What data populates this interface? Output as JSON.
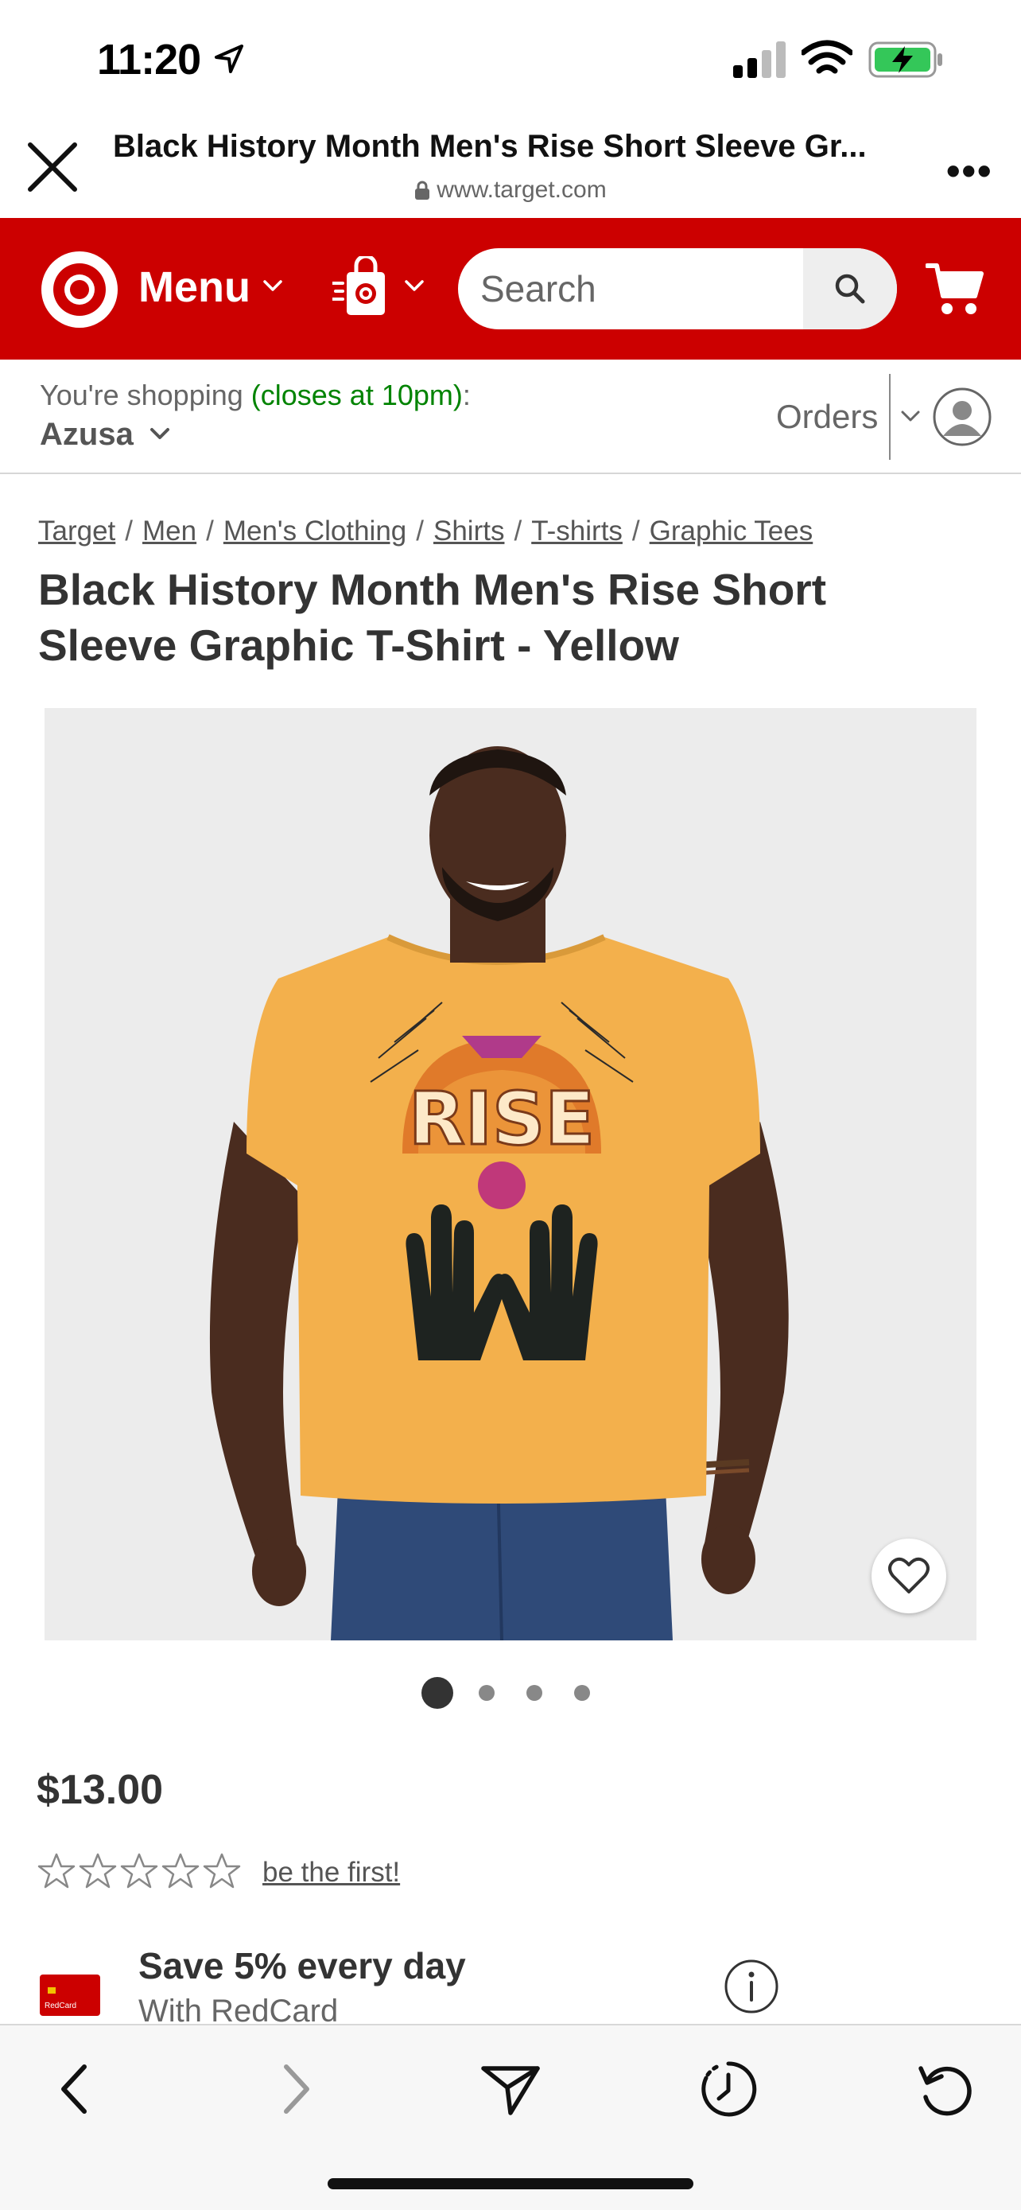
{
  "status_bar": {
    "time": "11:20"
  },
  "browser": {
    "page_title": "Black History Month Men's Rise Short Sleeve Gr...",
    "url": "www.target.com"
  },
  "header": {
    "menu_label": "Menu",
    "search_placeholder": "Search",
    "brand_color": "#cc0000"
  },
  "shopping": {
    "prefix": "You're shopping ",
    "closes": "(closes at 10pm)",
    "suffix": ":",
    "store": "Azusa",
    "orders_label": "Orders"
  },
  "breadcrumb": [
    "Target",
    "Men",
    "Men's Clothing",
    "Shirts",
    "T-shirts",
    "Graphic Tees"
  ],
  "product": {
    "title": "Black History Month Men's Rise Short Sleeve Graphic T-Shirt - Yellow",
    "shirt_print_text": "RISE",
    "price": "$13.00",
    "rating_stars": 0,
    "rating_link": "be the first!",
    "carousel": {
      "count": 4,
      "active_index": 0
    }
  },
  "redcard": {
    "title": "Save 5% every day",
    "subtitle": "With RedCard",
    "card_label": "RedCard"
  },
  "icons": {
    "close": "close-icon",
    "more": "more-icon",
    "logo": "target-bullseye-logo",
    "store": "store-pickup-icon",
    "search": "search-icon",
    "cart": "cart-icon",
    "account": "account-icon",
    "favorite": "heart-icon",
    "info": "info-icon",
    "back": "back-arrow-icon",
    "forward": "forward-arrow-icon",
    "share": "send-icon",
    "history": "history-icon",
    "reload": "reload-icon"
  }
}
